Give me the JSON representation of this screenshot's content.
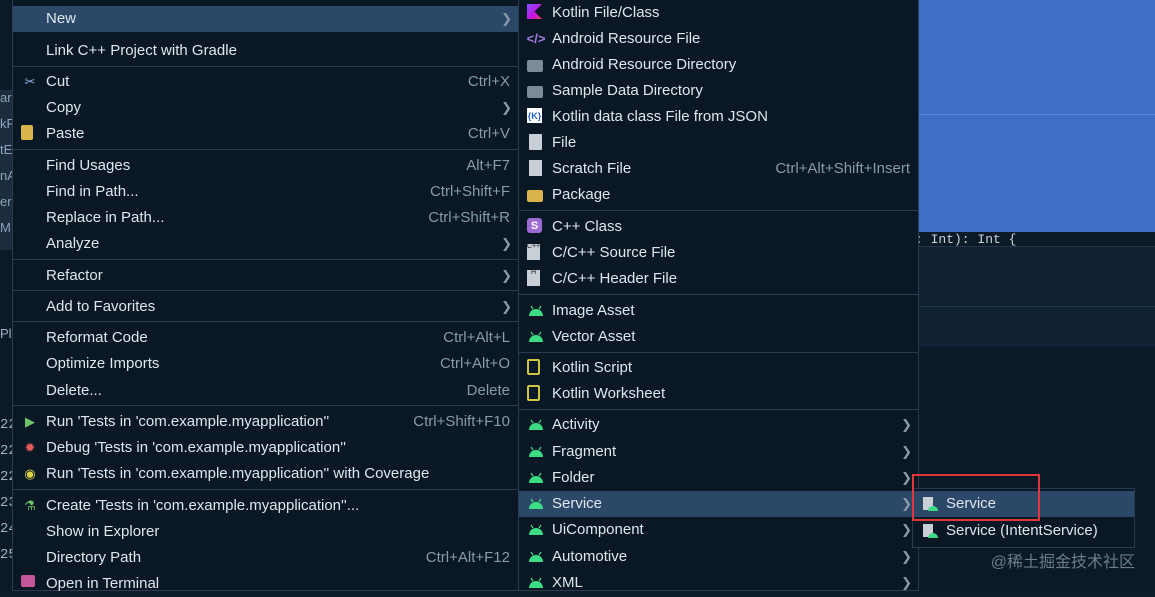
{
  "background": {
    "code_snippet": ": Int): Int {",
    "left_strip": [
      "ar",
      "kF",
      "tE",
      "nA",
      "er",
      "M"
    ],
    "gutter_numbers": [
      "22",
      "22",
      "22",
      "23",
      "24",
      "25"
    ],
    "left_label": "Pl"
  },
  "context_menu": {
    "new": {
      "label": "New"
    },
    "link_cpp": {
      "label": "Link C++ Project with Gradle"
    },
    "cut": {
      "label": "Cut",
      "shortcut": "Ctrl+X"
    },
    "copy": {
      "label": "Copy"
    },
    "paste": {
      "label": "Paste",
      "shortcut": "Ctrl+V"
    },
    "find_usages": {
      "label": "Find Usages",
      "shortcut": "Alt+F7"
    },
    "find_in_path": {
      "label": "Find in Path...",
      "shortcut": "Ctrl+Shift+F"
    },
    "replace_in_path": {
      "label": "Replace in Path...",
      "shortcut": "Ctrl+Shift+R"
    },
    "analyze": {
      "label": "Analyze"
    },
    "refactor": {
      "label": "Refactor"
    },
    "add_favorites": {
      "label": "Add to Favorites"
    },
    "reformat": {
      "label": "Reformat Code",
      "shortcut": "Ctrl+Alt+L"
    },
    "optimize": {
      "label": "Optimize Imports",
      "shortcut": "Ctrl+Alt+O"
    },
    "delete": {
      "label": "Delete...",
      "shortcut": "Delete"
    },
    "run_tests": {
      "label": "Run 'Tests in 'com.example.myapplication''",
      "shortcut": "Ctrl+Shift+F10"
    },
    "debug_tests": {
      "label": "Debug 'Tests in 'com.example.myapplication''"
    },
    "coverage_tests": {
      "label": "Run 'Tests in 'com.example.myapplication'' with Coverage"
    },
    "create_tests": {
      "label": "Create 'Tests in 'com.example.myapplication''..."
    },
    "show_explorer": {
      "label": "Show in Explorer"
    },
    "directory_path": {
      "label": "Directory Path",
      "shortcut": "Ctrl+Alt+F12"
    },
    "open_terminal": {
      "label": "Open in Terminal"
    }
  },
  "new_submenu": {
    "kotlin_file": "Kotlin File/Class",
    "android_resource_file": "Android Resource File",
    "android_resource_dir": "Android Resource Directory",
    "sample_data_dir": "Sample Data Directory",
    "kotlin_json": "Kotlin data class File from JSON",
    "file": "File",
    "scratch_file": {
      "label": "Scratch File",
      "shortcut": "Ctrl+Alt+Shift+Insert"
    },
    "package": "Package",
    "cpp_class": "C++ Class",
    "cpp_source": "C/C++ Source File",
    "cpp_header": "C/C++ Header File",
    "image_asset": "Image Asset",
    "vector_asset": "Vector Asset",
    "kotlin_script": "Kotlin Script",
    "kotlin_worksheet": "Kotlin Worksheet",
    "activity": "Activity",
    "fragment": "Fragment",
    "folder": "Folder",
    "service": "Service",
    "uicomponent": "UiComponent",
    "automotive": "Automotive",
    "xml": "XML"
  },
  "service_submenu": {
    "service": "Service",
    "intent_service": "Service (IntentService)"
  },
  "watermark": "@稀土掘金技术社区",
  "colors": {
    "selection": "#2c4868",
    "highlight_box": "#e0383a",
    "android_green": "#3ddc84"
  }
}
